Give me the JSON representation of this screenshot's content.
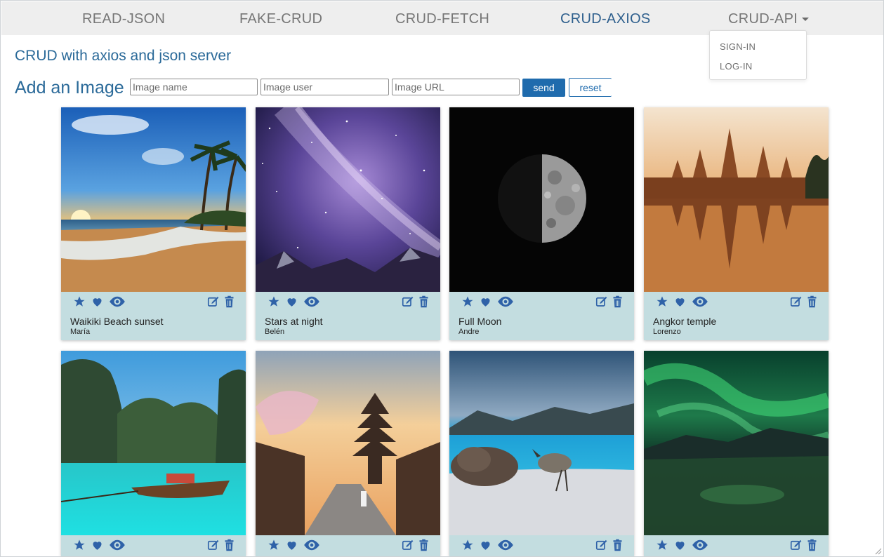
{
  "nav": {
    "items": [
      {
        "label": "READ-JSON"
      },
      {
        "label": "FAKE-CRUD"
      },
      {
        "label": "CRUD-FETCH"
      },
      {
        "label": "CRUD-AXIOS"
      },
      {
        "label": "CRUD-API"
      }
    ],
    "dropdown": [
      "SIGN-IN",
      "LOG-IN"
    ],
    "active_color": "#2e5f8d"
  },
  "page": {
    "subtitle": "CRUD with axios and json server",
    "form_title": "Add an Image",
    "inputs": {
      "name_placeholder": "Image name",
      "user_placeholder": "Image user",
      "url_placeholder": "Image URL"
    },
    "send_label": "send",
    "reset_label": "reset"
  },
  "icons": [
    "star-icon",
    "heart-icon",
    "eye-icon",
    "edit-icon",
    "trash-icon"
  ],
  "colors": {
    "accent": "#1f6bad",
    "card_bg": "#c3dde0",
    "icon": "#2f62a8"
  },
  "cards": [
    {
      "title": "Waikiki Beach sunset",
      "user": "María"
    },
    {
      "title": "Stars at night",
      "user": "Belén"
    },
    {
      "title": "Full Moon",
      "user": "Andre"
    },
    {
      "title": "Angkor temple",
      "user": "Lorenzo"
    },
    {
      "title": "",
      "user": ""
    },
    {
      "title": "",
      "user": ""
    },
    {
      "title": "",
      "user": ""
    },
    {
      "title": "",
      "user": ""
    }
  ]
}
